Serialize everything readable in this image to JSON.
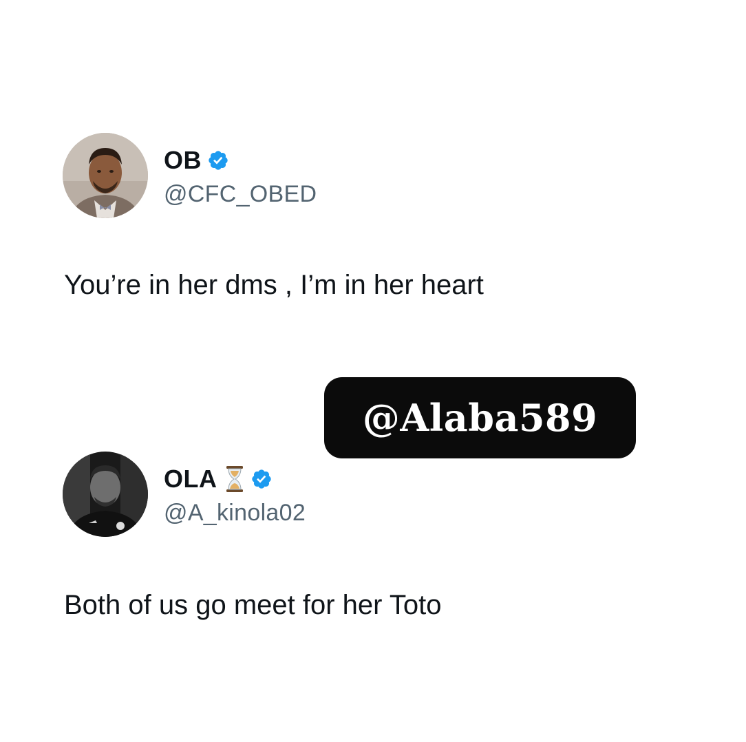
{
  "tweets": [
    {
      "display_name": "OB",
      "handle": "@CFC_OBED",
      "verified": true,
      "text": "You’re in her dms , I’m in her heart"
    },
    {
      "display_name": "OLA",
      "name_emoji": "hourglass-icon",
      "handle": "@A_kinola02",
      "verified": true,
      "text": "Both of us go meet for her Toto"
    }
  ],
  "watermark": {
    "text": "@Alaba589"
  },
  "colors": {
    "verified_badge": "#1d9bf0",
    "handle": "#536471",
    "text": "#0f1419",
    "watermark_bg": "#0b0b0b"
  }
}
